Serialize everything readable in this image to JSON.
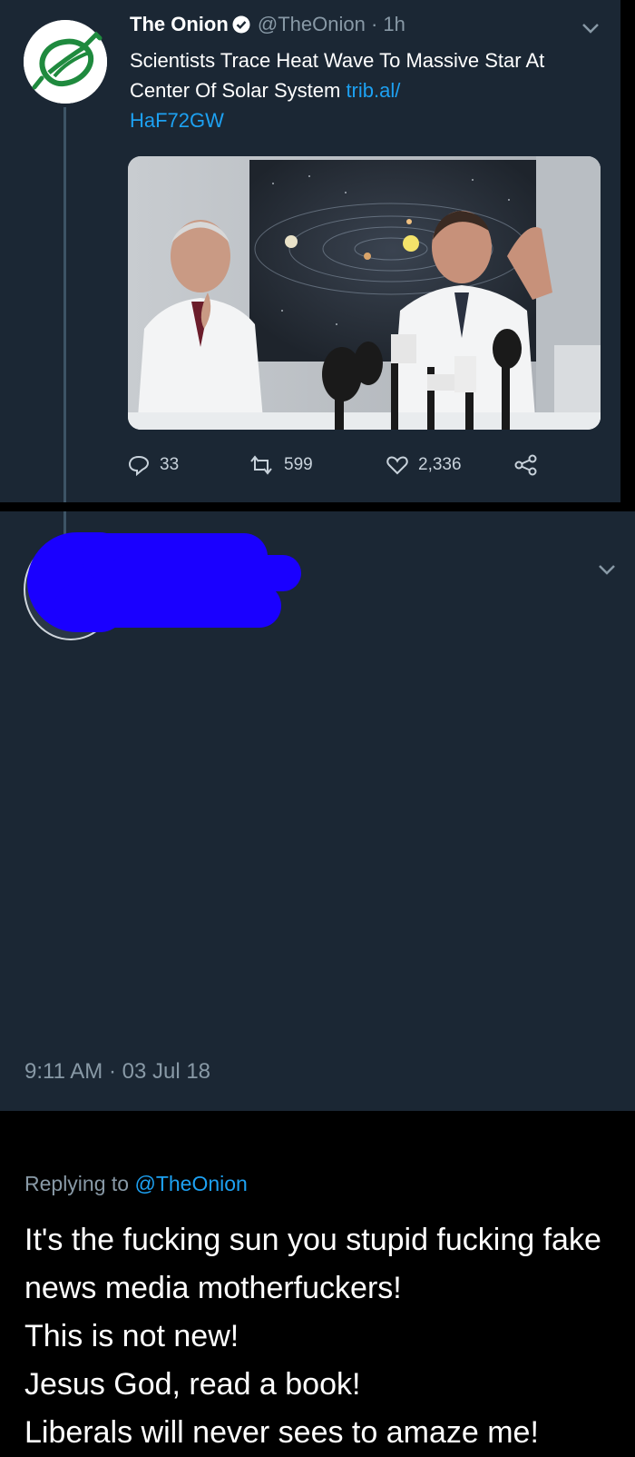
{
  "tweet": {
    "author_name": "The Onion",
    "handle": "@TheOnion",
    "time_sep": "·",
    "time": "1h",
    "text": "Scientists Trace Heat Wave To Massive Star At Center Of Solar System",
    "link_line1": "trib.al/",
    "link_line2": "HaF72GW",
    "stats": {
      "replies": "33",
      "retweets": "599",
      "likes": "2,336"
    },
    "icons": {
      "avatar": "onion-logo-icon",
      "verified": "verified-badge-icon",
      "reply": "reply-icon",
      "retweet": "retweet-icon",
      "like": "heart-icon",
      "share": "share-icon",
      "more": "chevron-down-icon"
    }
  },
  "reply": {
    "replying_prefix": "Replying to ",
    "replying_handle": "@TheOnion",
    "lines": [
      "It's the fucking sun you stupid fucking fake news media motherfuckers!",
      "This is not new!",
      "Jesus God, read a book!",
      "Liberals will never sees to amaze me!"
    ],
    "timestamp": "9:11 AM · 03 Jul 18",
    "icons": {
      "more": "chevron-down-icon"
    }
  },
  "colors": {
    "panel": "#1b2734",
    "link": "#1da1f2",
    "muted": "#8899a6",
    "redaction": "#1a00ff",
    "onion_green": "#1f8a3e"
  }
}
